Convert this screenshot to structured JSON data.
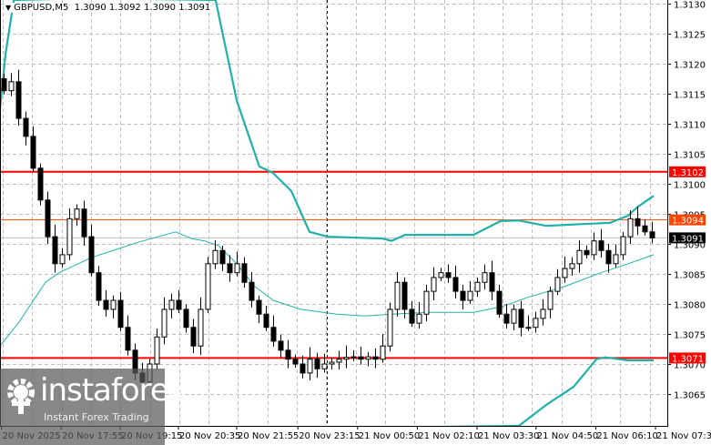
{
  "header": {
    "symbol": "GBPUSD,M5",
    "ohlc": "1.3090 1.3092 1.3090 1.3091"
  },
  "watermark": {
    "brand": "instaforex",
    "tagline": "Instant Forex Trading"
  },
  "colors": {
    "support_resistance": "#ff0000",
    "level_orange": "#ff4500",
    "band": "#20b2aa",
    "bid_line": "#c0c0c0"
  },
  "chart_data": {
    "type": "candlestick",
    "title": "GBPUSD,M5",
    "ylim": [
      1.30585,
      1.31305
    ],
    "y_ticks": [
      "1.3130",
      "1.3125",
      "1.3120",
      "1.3115",
      "1.3110",
      "1.3105",
      "1.3100",
      "1.3095",
      "1.3090",
      "1.3085",
      "1.3080",
      "1.3075",
      "1.3070",
      "1.3065"
    ],
    "x_tick_labels": [
      "20 Nov 2025",
      "20 Nov 17:55",
      "20 Nov 19:15",
      "20 Nov 20:35",
      "20 Nov 21:55",
      "20 Nov 23:15",
      "21 Nov 00:50",
      "21 Nov 02:10",
      "21 Nov 03:30",
      "21 Nov 04:50",
      "21 Nov 06:10",
      "21 Nov 07:30"
    ],
    "x_tick_index": [
      -0.3,
      7.9,
      16,
      24,
      32,
      40.4,
      48.6,
      56.8,
      65,
      73.1,
      81.3,
      89.5
    ],
    "closes": [
      1.31155,
      1.3117,
      1.31109,
      1.31079,
      1.31026,
      1.30973,
      1.30912,
      1.30867,
      1.30882,
      1.30942,
      1.30958,
      1.30912,
      1.30852,
      1.30806,
      1.30791,
      1.30806,
      1.30761,
      1.30723,
      1.30685,
      1.3067,
      1.307,
      1.30745,
      1.30791,
      1.30806,
      1.30791,
      1.30761,
      1.3073,
      1.30791,
      1.30867,
      1.30889,
      1.30867,
      1.30852,
      1.30867,
      1.30836,
      1.30806,
      1.30783,
      1.30761,
      1.30738,
      1.30723,
      1.30708,
      1.307,
      1.30685,
      1.30708,
      1.30692,
      1.307,
      1.30703,
      1.30708,
      1.30711,
      1.30712,
      1.30708,
      1.30712,
      1.30708,
      1.3073,
      1.30791,
      1.30836,
      1.30791,
      1.30768,
      1.30783,
      1.30821,
      1.30844,
      1.30852,
      1.30844,
      1.30821,
      1.30806,
      1.30821,
      1.30836,
      1.30852,
      1.30821,
      1.30783,
      1.30768,
      1.30791,
      1.30761,
      1.30761,
      1.30776,
      1.30791,
      1.30821,
      1.30844,
      1.30859,
      1.30867,
      1.30889,
      1.30882,
      1.30905,
      1.30889,
      1.30867,
      1.30882,
      1.30912,
      1.30942,
      1.3093,
      1.3092,
      1.3091
    ],
    "upper_band": [
      [
        -0.5,
        1.31124
      ],
      [
        0.25,
        1.31215
      ],
      [
        1.4,
        1.31306
      ],
      [
        12,
        1.3161
      ],
      [
        29.1,
        1.31306
      ],
      [
        32,
        1.31139
      ],
      [
        35.1,
        1.31029
      ],
      [
        37,
        1.31018
      ],
      [
        39.5,
        1.30988
      ],
      [
        42,
        1.3092
      ],
      [
        44.5,
        1.30912
      ],
      [
        52,
        1.30909
      ],
      [
        53.25,
        1.30905
      ],
      [
        55.1,
        1.30915
      ],
      [
        58.25,
        1.30915
      ],
      [
        64.5,
        1.30915
      ],
      [
        68.25,
        1.30938
      ],
      [
        70.75,
        1.30939
      ],
      [
        74.5,
        1.3093
      ],
      [
        79.5,
        1.30933
      ],
      [
        83.25,
        1.30935
      ],
      [
        85.75,
        1.30947
      ],
      [
        87,
        1.30961
      ],
      [
        89.25,
        1.3098
      ]
    ],
    "middle_line": [
      [
        -0.5,
        1.3073
      ],
      [
        2,
        1.30768
      ],
      [
        5.75,
        1.30836
      ],
      [
        7.6,
        1.30852
      ],
      [
        12,
        1.30877
      ],
      [
        18.25,
        1.30902
      ],
      [
        23.6,
        1.3092
      ],
      [
        25.75,
        1.30909
      ],
      [
        27.6,
        1.30905
      ],
      [
        29.5,
        1.30897
      ],
      [
        32,
        1.30867
      ],
      [
        34.5,
        1.30829
      ],
      [
        37,
        1.30806
      ],
      [
        40.75,
        1.30791
      ],
      [
        45.75,
        1.30783
      ],
      [
        49.5,
        1.3078
      ],
      [
        53.25,
        1.30783
      ],
      [
        58.25,
        1.30786
      ],
      [
        64.5,
        1.30786
      ],
      [
        68.25,
        1.30795
      ],
      [
        72,
        1.30811
      ],
      [
        77,
        1.30829
      ],
      [
        82,
        1.30852
      ],
      [
        85.75,
        1.30867
      ],
      [
        89.25,
        1.30882
      ]
    ],
    "lower_band": [
      [
        49.5,
        1.30518
      ],
      [
        70.75,
        1.30597
      ],
      [
        74.5,
        1.30632
      ],
      [
        78.25,
        1.30662
      ],
      [
        81.4,
        1.30708
      ],
      [
        82.6,
        1.30711
      ],
      [
        85.75,
        1.30706
      ],
      [
        89.25,
        1.30706
      ]
    ],
    "levels": [
      {
        "price": 1.3102,
        "label": "1.3102",
        "color": "#ff0000",
        "width": 2
      },
      {
        "price": 1.3094,
        "label": "1.3094",
        "color": "#ff4500",
        "width": 1
      },
      {
        "price": 1.3091,
        "label": "1.3091",
        "color": "#c0c0c0",
        "width": 1,
        "label_bg": "#000000"
      },
      {
        "price": 1.3071,
        "label": "1.3071",
        "color": "#ff0000",
        "width": 2
      }
    ],
    "separator_index": 44.4
  }
}
